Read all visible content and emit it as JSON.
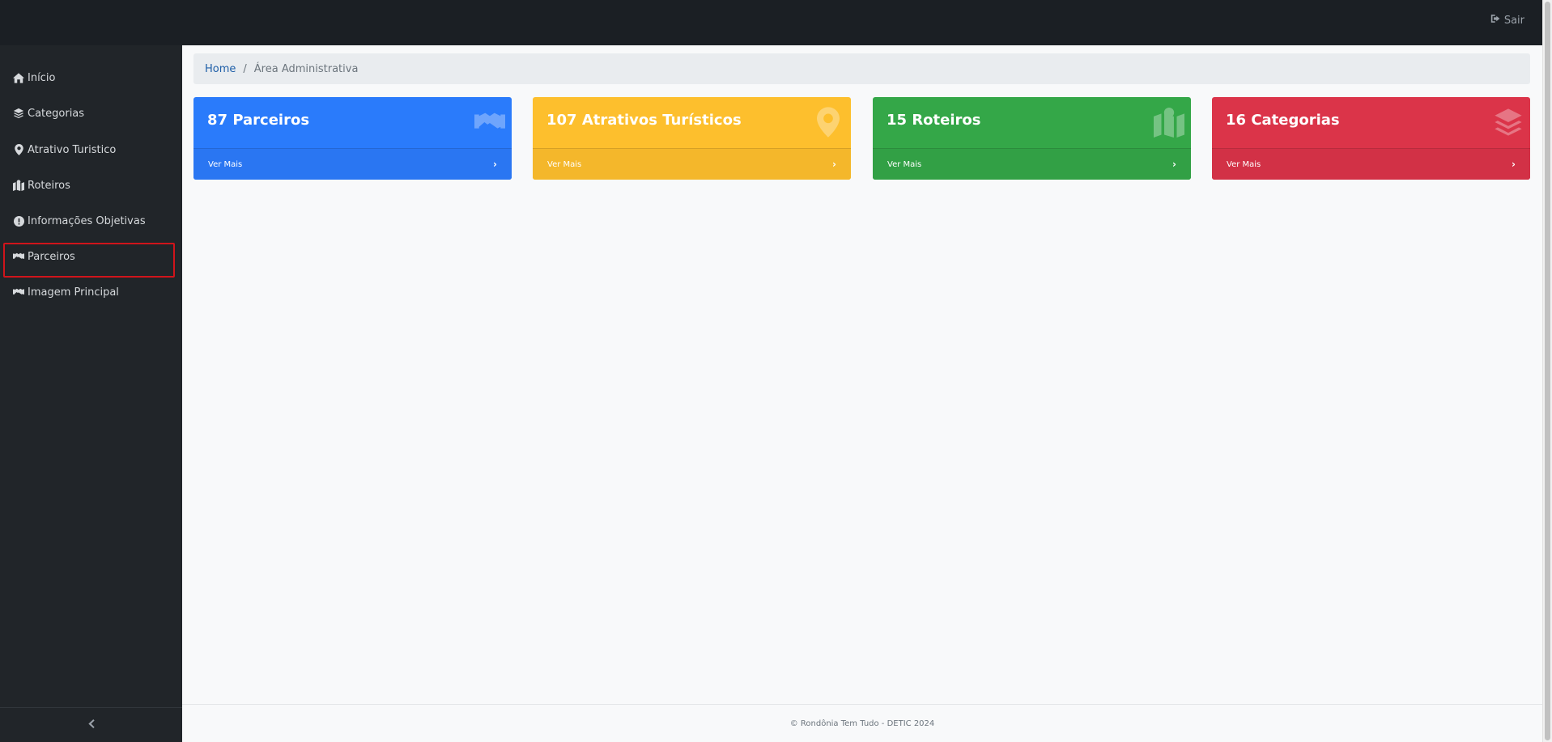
{
  "header": {
    "logout_label": "Sair"
  },
  "sidebar": {
    "items": [
      {
        "label": "Início",
        "icon": "home-icon"
      },
      {
        "label": "Categorias",
        "icon": "layers-icon"
      },
      {
        "label": "Atrativo Turistico",
        "icon": "map-marker-icon"
      },
      {
        "label": "Roteiros",
        "icon": "map-icon"
      },
      {
        "label": "Informações Objetivas",
        "icon": "info-circle-icon"
      },
      {
        "label": "Parceiros",
        "icon": "handshake-icon"
      },
      {
        "label": "Imagem Principal",
        "icon": "handshake-icon"
      }
    ],
    "collapse_icon": "chevron-left-icon"
  },
  "breadcrumb": {
    "home": "Home",
    "separator": "/",
    "current": "Área Administrativa"
  },
  "cards": [
    {
      "title": "87 Parceiros",
      "link": "Ver Mais",
      "color": "#2a7bfb",
      "footer_color": "#2a76f2",
      "icon": "handshake-icon"
    },
    {
      "title": "107 Atrativos Turísticos",
      "link": "Ver Mais",
      "color": "#fdbf2d",
      "footer_color": "#f4b72b",
      "icon": "map-marker-icon"
    },
    {
      "title": "15 Roteiros",
      "link": "Ver Mais",
      "color": "#34a748",
      "footer_color": "#32a045",
      "icon": "map-icon"
    },
    {
      "title": "16 Categorias",
      "link": "Ver Mais",
      "color": "#db3449",
      "footer_color": "#d23146",
      "icon": "layers-icon"
    }
  ],
  "footer": {
    "text": "© Rondônia Tem Tudo - DETIC 2024"
  },
  "colors": {
    "topbar": "#1b1f24",
    "sidebar": "#212529",
    "highlight": "#d0141b"
  }
}
